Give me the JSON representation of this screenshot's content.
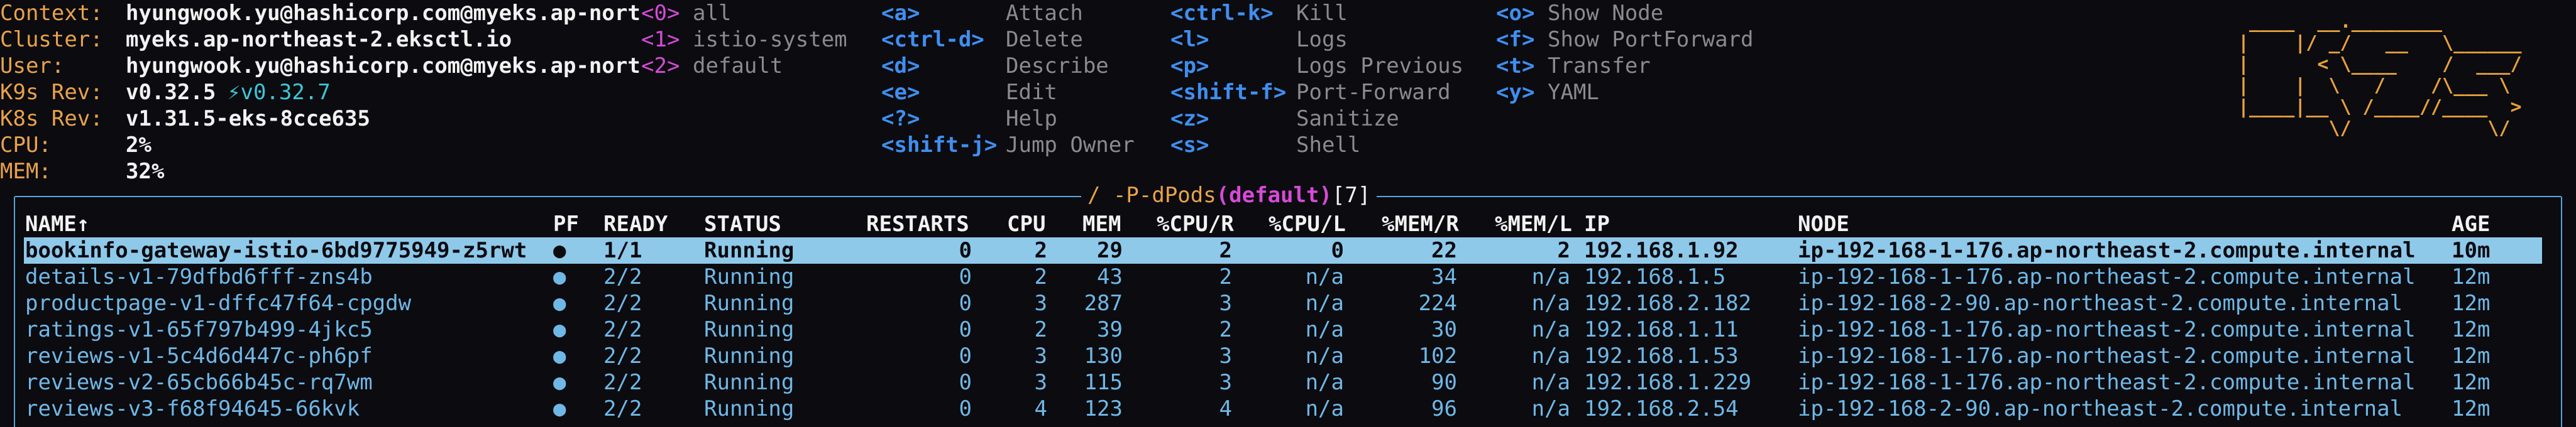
{
  "info": [
    {
      "label": "Context:",
      "value": "hyungwook.yu@hashicorp.com@myeks.ap-nort"
    },
    {
      "label": "Cluster:",
      "value": "myeks.ap-northeast-2.eksctl.io"
    },
    {
      "label": "User:",
      "value": "hyungwook.yu@hashicorp.com@myeks.ap-nort"
    },
    {
      "label": "K9s Rev:",
      "value": "v0.32.5",
      "extra": "⚡v0.32.7"
    },
    {
      "label": "K8s Rev:",
      "value": "v1.31.5-eks-8cce635"
    },
    {
      "label": "CPU:",
      "value": "2%"
    },
    {
      "label": "MEM:",
      "value": "32%"
    }
  ],
  "namespaces": [
    {
      "key": "<0>",
      "name": "all"
    },
    {
      "key": "<1>",
      "name": "istio-system"
    },
    {
      "key": "<2>",
      "name": "default"
    }
  ],
  "shortcuts_col1": [
    {
      "key": "<a>",
      "action": "Attach"
    },
    {
      "key": "<ctrl-d>",
      "action": "Delete"
    },
    {
      "key": "<d>",
      "action": "Describe"
    },
    {
      "key": "<e>",
      "action": "Edit"
    },
    {
      "key": "<?>",
      "action": "Help"
    },
    {
      "key": "<shift-j>",
      "action": "Jump Owner"
    }
  ],
  "shortcuts_col2": [
    {
      "key": "<ctrl-k>",
      "action": "Kill"
    },
    {
      "key": "<l>",
      "action": "Logs"
    },
    {
      "key": "<p>",
      "action": "Logs Previous"
    },
    {
      "key": "<shift-f>",
      "action": "Port-Forward"
    },
    {
      "key": "<z>",
      "action": "Sanitize"
    },
    {
      "key": "<s>",
      "action": "Shell"
    }
  ],
  "shortcuts_col3": [
    {
      "key": "<o>",
      "action": "Show Node"
    },
    {
      "key": "<f>",
      "action": "Show PortForward"
    },
    {
      "key": "<t>",
      "action": "Transfer"
    },
    {
      "key": "<y>",
      "action": "YAML"
    }
  ],
  "logo_lines": [
    " ____  __.________        ",
    "|    |/ _/   __   \\______",
    "|      < \\____    /  ___/",
    "|    |  \\   /    /\\___ \\ ",
    "|____|__ \\ /____//____  >",
    "        \\/            \\/ "
  ],
  "title": {
    "prefix": "/ -P-dPods",
    "namespace": "(default)",
    "count": "[7]"
  },
  "columns": [
    "NAME↑",
    "PF",
    "READY",
    "STATUS",
    "RESTARTS",
    "CPU",
    "MEM",
    "%CPU/R",
    "%CPU/L",
    "%MEM/R",
    "%MEM/L",
    "IP",
    "NODE",
    "AGE"
  ],
  "rows": [
    [
      "bookinfo-gateway-istio-6bd9775949-z5rwt",
      "●",
      "1/1",
      "Running",
      "0",
      "2",
      "29",
      "2",
      "0",
      "22",
      "2",
      "192.168.1.92",
      "ip-192-168-1-176.ap-northeast-2.compute.internal",
      "10m"
    ],
    [
      "details-v1-79dfbd6fff-zns4b",
      "●",
      "2/2",
      "Running",
      "0",
      "2",
      "43",
      "2",
      "n/a",
      "34",
      "n/a",
      "192.168.1.5",
      "ip-192-168-1-176.ap-northeast-2.compute.internal",
      "12m"
    ],
    [
      "productpage-v1-dffc47f64-cpgdw",
      "●",
      "2/2",
      "Running",
      "0",
      "3",
      "287",
      "3",
      "n/a",
      "224",
      "n/a",
      "192.168.2.182",
      "ip-192-168-2-90.ap-northeast-2.compute.internal",
      "12m"
    ],
    [
      "ratings-v1-65f797b499-4jkc5",
      "●",
      "2/2",
      "Running",
      "0",
      "2",
      "39",
      "2",
      "n/a",
      "30",
      "n/a",
      "192.168.1.11",
      "ip-192-168-1-176.ap-northeast-2.compute.internal",
      "12m"
    ],
    [
      "reviews-v1-5c4d6d447c-ph6pf",
      "●",
      "2/2",
      "Running",
      "0",
      "3",
      "130",
      "3",
      "n/a",
      "102",
      "n/a",
      "192.168.1.53",
      "ip-192-168-1-176.ap-northeast-2.compute.internal",
      "12m"
    ],
    [
      "reviews-v2-65cb66b45c-rq7wm",
      "●",
      "2/2",
      "Running",
      "0",
      "3",
      "115",
      "3",
      "n/a",
      "90",
      "n/a",
      "192.168.1.229",
      "ip-192-168-1-176.ap-northeast-2.compute.internal",
      "12m"
    ],
    [
      "reviews-v3-f68f94645-66kvk",
      "●",
      "2/2",
      "Running",
      "0",
      "4",
      "123",
      "4",
      "n/a",
      "96",
      "n/a",
      "192.168.2.54",
      "ip-192-168-2-90.ap-northeast-2.compute.internal",
      "12m"
    ]
  ],
  "selected_row": 0,
  "colors": {
    "label": "#e9a24a",
    "key_blue": "#3f8ff0",
    "key_magenta": "#d84ad8",
    "row_text": "#6fb8e6",
    "selection_bg": "#8ec9ea",
    "frame": "#5aa6d6"
  }
}
